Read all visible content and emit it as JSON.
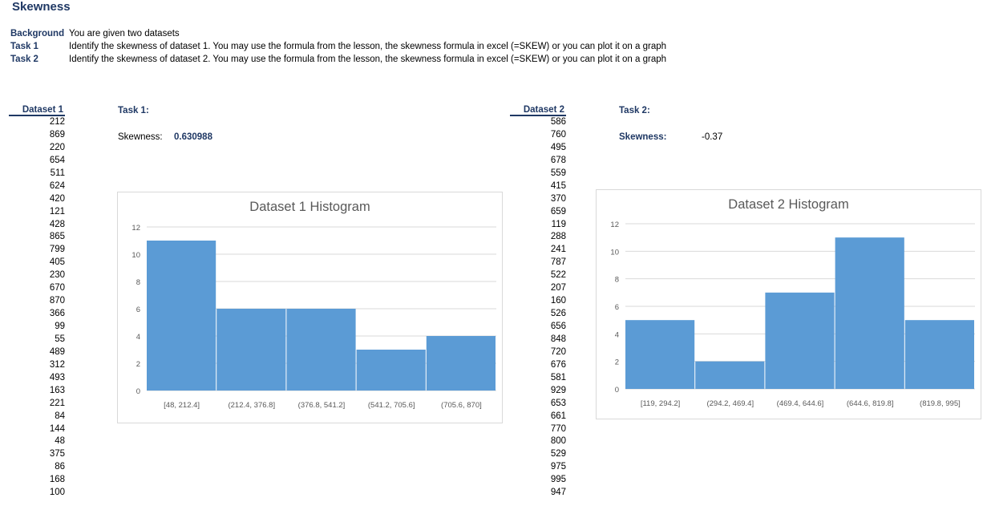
{
  "page": {
    "title": "Skewness",
    "background_label": "Background",
    "background_text": "You are given two datasets",
    "task1_label": "Task 1",
    "task1_text": "Identify the skewness of dataset 1. You may use the formula from the lesson, the skewness formula in excel (=SKEW) or you can plot it on a graph",
    "task2_label": "Task 2",
    "task2_text": "Identify the skewness of dataset 2. You may use the formula from the lesson, the skewness formula in excel (=SKEW) or you can plot it on a graph"
  },
  "dataset1": {
    "header": "Dataset 1",
    "values": [
      "212",
      "869",
      "220",
      "654",
      "511",
      "624",
      "420",
      "121",
      "428",
      "865",
      "799",
      "405",
      "230",
      "670",
      "870",
      "366",
      "99",
      "55",
      "489",
      "312",
      "493",
      "163",
      "221",
      "84",
      "144",
      "48",
      "375",
      "86",
      "168",
      "100"
    ]
  },
  "dataset2": {
    "header": "Dataset 2",
    "values": [
      "586",
      "760",
      "495",
      "678",
      "559",
      "415",
      "370",
      "659",
      "119",
      "288",
      "241",
      "787",
      "522",
      "207",
      "160",
      "526",
      "656",
      "848",
      "720",
      "676",
      "581",
      "929",
      "653",
      "661",
      "770",
      "800",
      "529",
      "975",
      "995",
      "947"
    ]
  },
  "task1": {
    "heading": "Task 1:",
    "skew_label": "Skewness:",
    "skew_value": "0.630988"
  },
  "task2": {
    "heading": "Task 2:",
    "skew_label": "Skewness:",
    "skew_value": "-0.37"
  },
  "colors": {
    "heading": "#1f3864",
    "bar": "#5b9bd5",
    "grid": "#d9d9d9",
    "axis_text": "#595959"
  },
  "chart_data": [
    {
      "type": "bar",
      "title": "Dataset 1 Histogram",
      "categories": [
        "[48, 212.4]",
        "(212.4, 376.8]",
        "(376.8, 541.2]",
        "(541.2, 705.6]",
        "(705.6, 870]"
      ],
      "values": [
        11,
        6,
        6,
        3,
        4
      ],
      "ylim": [
        0,
        12
      ],
      "yticks": [
        0,
        2,
        4,
        6,
        8,
        10,
        12
      ],
      "grid": true,
      "xlabel": "",
      "ylabel": ""
    },
    {
      "type": "bar",
      "title": "Dataset 2 Histogram",
      "categories": [
        "[119, 294.2]",
        "(294.2, 469.4]",
        "(469.4, 644.6]",
        "(644.6, 819.8]",
        "(819.8, 995]"
      ],
      "values": [
        5,
        2,
        7,
        11,
        5
      ],
      "ylim": [
        0,
        12
      ],
      "yticks": [
        0,
        2,
        4,
        6,
        8,
        10,
        12
      ],
      "grid": true,
      "xlabel": "",
      "ylabel": ""
    }
  ]
}
